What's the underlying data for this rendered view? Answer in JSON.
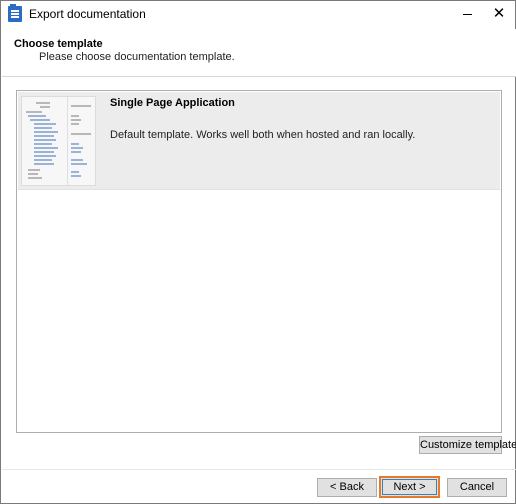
{
  "window": {
    "title": "Export documentation",
    "minimize_glyph": "",
    "close_glyph": "✕"
  },
  "header": {
    "title": "Choose template",
    "subtitle": "Please choose documentation template."
  },
  "templates": [
    {
      "name": "Single Page Application",
      "description": "Default template. Works well both when hosted and ran locally.",
      "thumbnail_icon": "spa-template-preview",
      "selected": true
    }
  ],
  "buttons": {
    "customize": "Customize template",
    "back": "< Back",
    "next": "Next >",
    "cancel": "Cancel"
  },
  "colors": {
    "selection_bg": "#ececec",
    "default_button_outline": "#e8782a",
    "app_icon": "#2b6cc4"
  }
}
